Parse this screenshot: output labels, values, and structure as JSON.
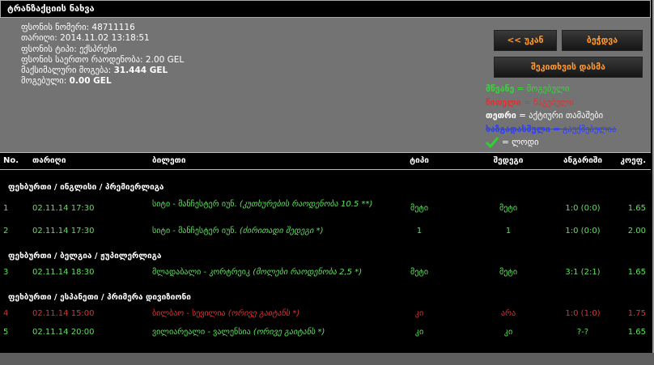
{
  "title": "ტრანზაქციის ნახვა",
  "info": {
    "ticket_number_label": "ფსონის ნომერი:",
    "ticket_number": "48711116",
    "date_label": "თარიღი:",
    "date": "2014.11.02 13:18:51",
    "type_label": "ფსონის ტიპი:",
    "type": "ექსპრესი",
    "amount_label": "ფსონის საერთო რაოდენობა:",
    "amount": "2.00 GEL",
    "max_win_label": "მაქსიმალური მოგება:",
    "max_win": "31.444 GEL",
    "win_label": "მოგებული:",
    "win": "0.00 GEL"
  },
  "buttons": {
    "back": "<< უკან",
    "print": "ბეჭდვა",
    "check": "შეკითხვის დასმა"
  },
  "legend": {
    "green_key": "მწვანე",
    "green_text": "= მოგებული",
    "red_key": "წითელი",
    "red_text": "= წაგებული",
    "white_key": "თეთრი",
    "white_text": "= აქტიური თამაშები",
    "blue_key": "ხაზგადასმული",
    "blue_text": "= გაუქმებულია",
    "check_text": "= ლოდი"
  },
  "columns": [
    "No.",
    "თარიღი",
    "ბილეთი",
    "ტიპი",
    "შედეგი",
    "ანგარიში",
    "კოეფ."
  ],
  "groups": [
    {
      "name": "ფეხბურთი / ინგლისი / პრემიერლიგა",
      "rows": [
        {
          "no": "1",
          "date": "02.11.14 17:30",
          "ticket": "სიტი - მანჩესტერ იუნ.",
          "market": "(კუთხურების რაოდენობა 10.5 **)",
          "type": "მეტი",
          "result": "მეტი",
          "score": "1:0 (0:0)",
          "coef": "1.65",
          "status": "green"
        },
        {
          "no": "2",
          "date": "02.11.14 17:30",
          "ticket": "სიტი - მანჩესტერ იუნ.",
          "market": "(ძირითადი შედეგი *)",
          "type": "1",
          "result": "1",
          "score": "1:0 (0:0)",
          "coef": "2.00",
          "status": "green"
        }
      ]
    },
    {
      "name": "ფეხბურთი / ბელგია / ჟუპილერლიგა",
      "rows": [
        {
          "no": "3",
          "date": "02.11.14 18:30",
          "ticket": "მლადაბალი - კორტრეიკ",
          "market": "(მოლები რაოდენობა 2,5 *)",
          "type": "მეტი",
          "result": "მეტი",
          "score": "3:1 (2:1)",
          "coef": "1.65",
          "status": "green"
        }
      ]
    },
    {
      "name": "ფეხბურთი / ესპანეთი / პრიმერა დივიზიონი",
      "rows": [
        {
          "no": "4",
          "date": "02.11.14 15:00",
          "ticket": "ბილბაო - სევილია",
          "market": "(ორივე გაიტანს *)",
          "type": "კი",
          "result": "არა",
          "score": "1:0 (1:0)",
          "coef": "1.75",
          "status": "red"
        },
        {
          "no": "5",
          "date": "02.11.14 20:00",
          "ticket": "ვილიარეალი - ვალენსია",
          "market": "(ორივე გაიტანს *)",
          "type": "კი",
          "result": "კი",
          "score": "?-?",
          "coef": "1.65",
          "status": "green"
        }
      ]
    }
  ],
  "colors": {
    "accent_orange": "#ff9a2e",
    "win_green": "#5fe05f",
    "lose_red": "#e23030",
    "cancel_blue": "#2b3fff"
  }
}
